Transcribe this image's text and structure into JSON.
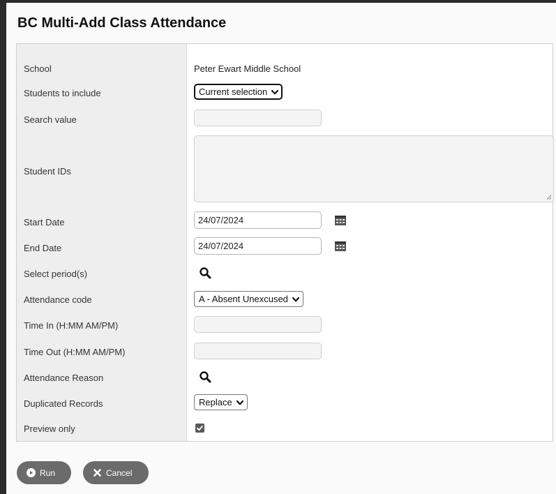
{
  "dialog": {
    "title": "BC Multi-Add Class Attendance"
  },
  "fields": {
    "school": {
      "label": "School",
      "value": "Peter Ewart Middle School"
    },
    "students_to_include": {
      "label": "Students to include",
      "value": "Current selection"
    },
    "search_value": {
      "label": "Search value",
      "value": ""
    },
    "student_ids": {
      "label": "Student IDs",
      "value": ""
    },
    "start_date": {
      "label": "Start Date",
      "value": "24/07/2024",
      "icon": "calendar-icon"
    },
    "end_date": {
      "label": "End Date",
      "value": "24/07/2024",
      "icon": "calendar-icon"
    },
    "select_periods": {
      "label": "Select period(s)",
      "icon": "search-icon"
    },
    "attendance_code": {
      "label": "Attendance code",
      "value": "A - Absent Unexcused"
    },
    "time_in": {
      "label": "Time In (H:MM AM/PM)",
      "value": ""
    },
    "time_out": {
      "label": "Time Out (H:MM AM/PM)",
      "value": ""
    },
    "attendance_reason": {
      "label": "Attendance Reason",
      "icon": "search-icon"
    },
    "duplicated_records": {
      "label": "Duplicated Records",
      "value": "Replace"
    },
    "preview_only": {
      "label": "Preview only",
      "checked": true
    }
  },
  "buttons": {
    "run": {
      "label": "Run",
      "icon": "play-circle-icon"
    },
    "cancel": {
      "label": "Cancel",
      "icon": "close-icon"
    }
  },
  "colors": {
    "button_bg": "#6b6b6b",
    "label_col_bg": "#eeeeee",
    "checkbox": "#5a5a5a"
  }
}
